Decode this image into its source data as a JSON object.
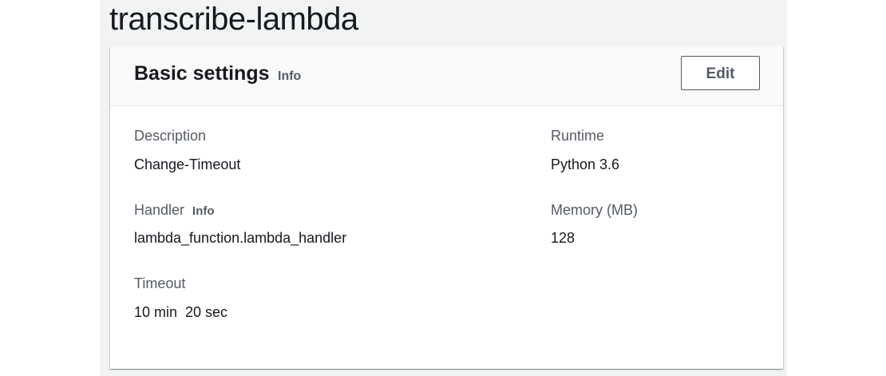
{
  "page": {
    "title": "transcribe-lambda"
  },
  "basic_settings": {
    "title": "Basic settings",
    "info_label": "Info",
    "edit_label": "Edit",
    "description": {
      "label": "Description",
      "value": "Change-Timeout"
    },
    "handler": {
      "label": "Handler",
      "info_label": "Info",
      "value": "lambda_function.lambda_handler"
    },
    "timeout": {
      "label": "Timeout",
      "value": "10 min  20 sec"
    },
    "runtime": {
      "label": "Runtime",
      "value": "Python 3.6"
    },
    "memory": {
      "label": "Memory (MB)",
      "value": "128"
    }
  },
  "colors": {
    "page_background": "#f2f3f3",
    "card_background": "#ffffff",
    "header_background": "#fafafa",
    "primary_text": "#16191f",
    "secondary_text": "#545b64"
  }
}
